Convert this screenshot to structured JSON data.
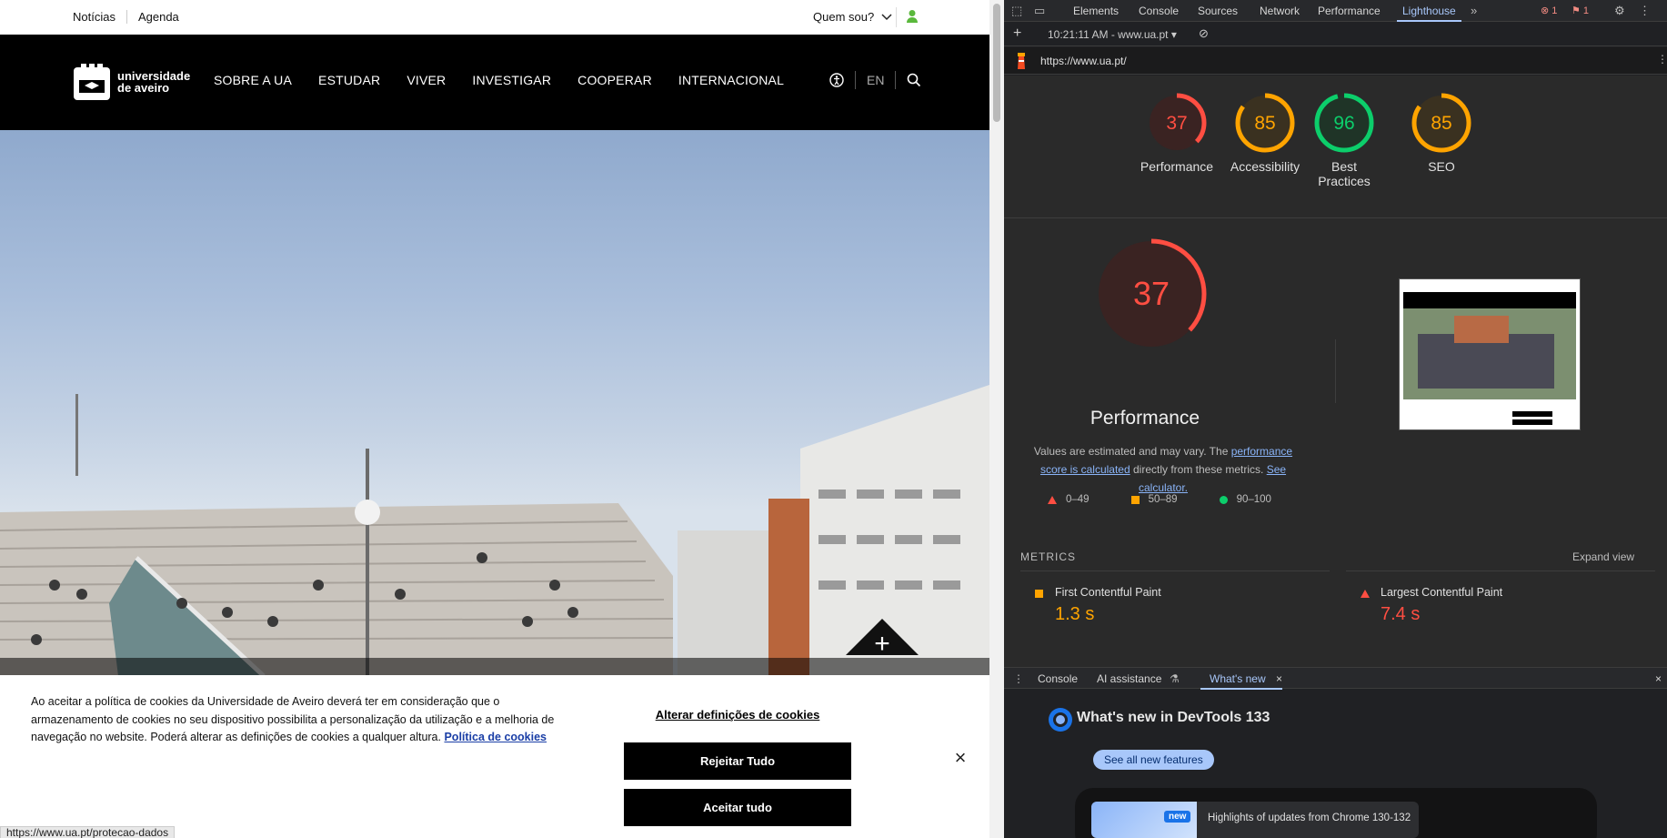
{
  "site": {
    "topbar": {
      "link1": "Notícias",
      "link2": "Agenda",
      "quem": "Quem sou?"
    },
    "logo": {
      "line1": "universidade",
      "line2": "de aveiro"
    },
    "nav": [
      "SOBRE A UA",
      "ESTUDAR",
      "VIVER",
      "INVESTIGAR",
      "COOPERAR",
      "INTERNACIONAL"
    ],
    "lang": "EN",
    "cookie": {
      "message": "Ao aceitar a política de cookies da Universidade de Aveiro deverá ter em consideração que o armazenamento de cookies no seu dispositivo possibilita a personalização da utilização e a melhoria de navegação no website. Poderá alterar as definições de cookies a qualquer altura.",
      "policy_link": "Política de cookies",
      "alter": "Alterar definições de cookies",
      "reject": "Rejeitar Tudo",
      "accept": "Aceitar tudo",
      "close": "×"
    },
    "status_url": "https://www.ua.pt/protecao-dados"
  },
  "devtools": {
    "tabs": [
      "Elements",
      "Console",
      "Sources",
      "Network",
      "Performance",
      "Lighthouse"
    ],
    "active_tab": "Lighthouse",
    "errors": "1",
    "issues": "1",
    "report_time": "10:21:11 AM - www.ua.pt",
    "url": "https://www.ua.pt/",
    "scores": [
      {
        "label": "Performance",
        "value": "37",
        "color": "#ff4e42",
        "fraction": 0.37
      },
      {
        "label": "Accessibility",
        "value": "85",
        "color": "#ffa400",
        "fraction": 0.85
      },
      {
        "label": "Best Practices",
        "value": "96",
        "color": "#0cce6b",
        "fraction": 0.96
      },
      {
        "label": "SEO",
        "value": "85",
        "color": "#ffa400",
        "fraction": 0.85
      }
    ],
    "perf": {
      "value": "37",
      "title": "Performance",
      "desc_prefix": "Values are estimated and may vary. The ",
      "desc_link1": "performance score is calculated",
      "desc_mid": " directly from these metrics. ",
      "desc_link2": "See calculator."
    },
    "legend": [
      "0–49",
      "50–89",
      "90–100"
    ],
    "metrics_heading": "METRICS",
    "expand": "Expand view",
    "metrics": [
      {
        "name": "First Contentful Paint",
        "value": "1.3 s",
        "color": "#ffa400"
      },
      {
        "name": "Largest Contentful Paint",
        "value": "7.4 s",
        "color": "#ff4e42"
      }
    ],
    "drawer_tabs": [
      "Console",
      "AI assistance",
      "What's new"
    ],
    "whatsnew": {
      "title": "What's new in DevTools 133",
      "button": "See all new features",
      "badge": "new",
      "card_text": "Highlights of updates from Chrome 130-132"
    }
  }
}
